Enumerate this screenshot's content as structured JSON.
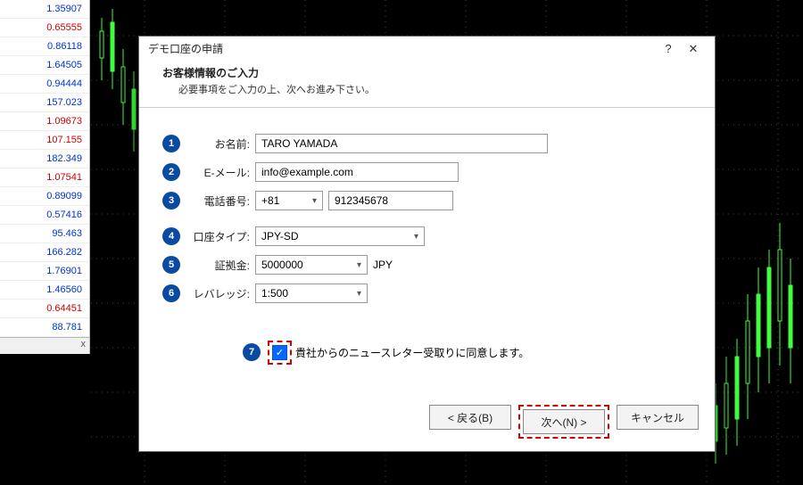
{
  "dialog": {
    "title": "デモ口座の申請",
    "header_title": "お客様情報のご入力",
    "header_sub": "必要事項をご入力の上、次へお進み下さい。",
    "rows": {
      "name_label": "お名前:",
      "name_value": "TARO YAMADA",
      "email_label": "E-メール:",
      "email_value": "info@example.com",
      "phone_label": "電話番号:",
      "phone_cc": "+81",
      "phone_num": "912345678",
      "account_label": "口座タイプ:",
      "account_value": "JPY-SD",
      "deposit_label": "証拠金:",
      "deposit_value": "5000000",
      "deposit_ccy": "JPY",
      "leverage_label": "レバレッジ:",
      "leverage_value": "1:500",
      "consent_text": "貴社からのニュースレター受取りに同意します。"
    },
    "buttons": {
      "back": "< 戻る(B)",
      "next": "次へ(N) >",
      "cancel": "キャンセル"
    },
    "help": "?",
    "close": "✕"
  },
  "quotes": [
    {
      "v": "1.35907",
      "d": "up"
    },
    {
      "v": "0.65555",
      "d": "down"
    },
    {
      "v": "0.86118",
      "d": "up"
    },
    {
      "v": "1.64505",
      "d": "up"
    },
    {
      "v": "0.94444",
      "d": "up"
    },
    {
      "v": "157.023",
      "d": "up"
    },
    {
      "v": "1.09673",
      "d": "down"
    },
    {
      "v": "107.155",
      "d": "down"
    },
    {
      "v": "182.349",
      "d": "up"
    },
    {
      "v": "1.07541",
      "d": "down"
    },
    {
      "v": "0.89099",
      "d": "up"
    },
    {
      "v": "0.57416",
      "d": "up"
    },
    {
      "v": "95.463",
      "d": "up"
    },
    {
      "v": "166.282",
      "d": "up"
    },
    {
      "v": "1.76901",
      "d": "up"
    },
    {
      "v": "1.46560",
      "d": "up"
    },
    {
      "v": "0.64451",
      "d": "down"
    },
    {
      "v": "88.781",
      "d": "up"
    }
  ],
  "panel_close": "x"
}
